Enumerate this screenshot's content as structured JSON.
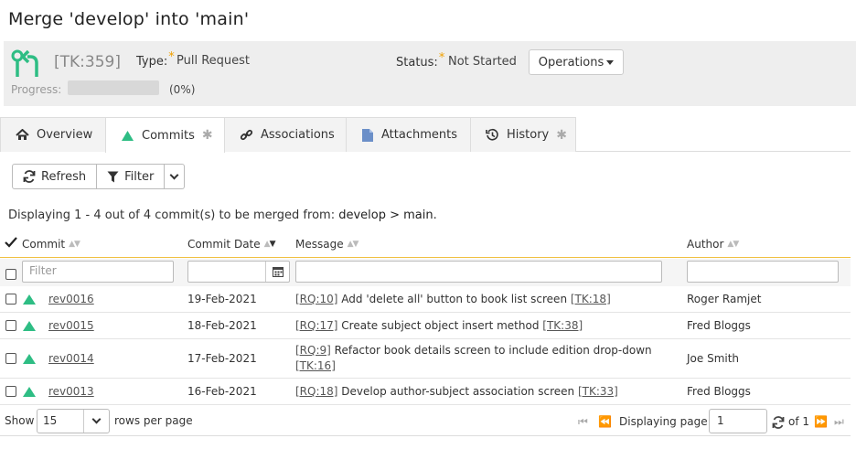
{
  "page_title": "Merge 'develop' into 'main'",
  "header": {
    "token": "[TK:359]",
    "type_label": "Type:",
    "type_value": "Pull Request",
    "status_label": "Status:",
    "status_value": "Not Started",
    "operations_label": "Operations",
    "progress_label": "Progress:",
    "progress_value": "(0%)",
    "progress_fraction": 0,
    "required_star": "*"
  },
  "tabs": [
    {
      "label": "Overview",
      "icon": "home-icon"
    },
    {
      "label": "Commits",
      "icon": "triangle-icon",
      "star": "✱"
    },
    {
      "label": "Associations",
      "icon": "link-icon"
    },
    {
      "label": "Attachments",
      "icon": "document-icon"
    },
    {
      "label": "History",
      "icon": "history-icon",
      "star": "✱"
    }
  ],
  "toolbar": {
    "refresh": "Refresh",
    "filter": "Filter"
  },
  "display": {
    "prefix": "Displaying 1 - 4 out of 4 commit(s) to be merged from:",
    "branches": "develop > main",
    "suffix": "."
  },
  "columns": {
    "commit": "Commit",
    "commit_date": "Commit Date",
    "message": "Message",
    "author": "Author"
  },
  "filter_placeholder": "Filter",
  "rows": [
    {
      "rev": "rev0016",
      "date": "19-Feb-2021",
      "req": "[RQ:10]",
      "msg": "Add 'delete all' button to book list screen",
      "tk": "[TK:18]",
      "author": "Roger Ramjet"
    },
    {
      "rev": "rev0015",
      "date": "18-Feb-2021",
      "req": "[RQ:17]",
      "msg": "Create subject object insert method",
      "tk": "[TK:38]",
      "author": "Fred Bloggs"
    },
    {
      "rev": "rev0014",
      "date": "17-Feb-2021",
      "req": "[RQ:9]",
      "msg": "Refactor book details screen to include edition drop-down",
      "tk": "[TK:16]",
      "author": "Joe Smith"
    },
    {
      "rev": "rev0013",
      "date": "16-Feb-2021",
      "req": "[RQ:18]",
      "msg": "Develop author-subject association screen",
      "tk": "[TK:33]",
      "author": "Fred Bloggs"
    }
  ],
  "footer": {
    "show": "Show",
    "page_size": "15",
    "rows_per_page": "rows per page",
    "displaying_page": "Displaying page",
    "page": "1",
    "of": "of 1"
  },
  "colors": {
    "accent_green": "#2ebd84",
    "required": "#f0a000"
  }
}
